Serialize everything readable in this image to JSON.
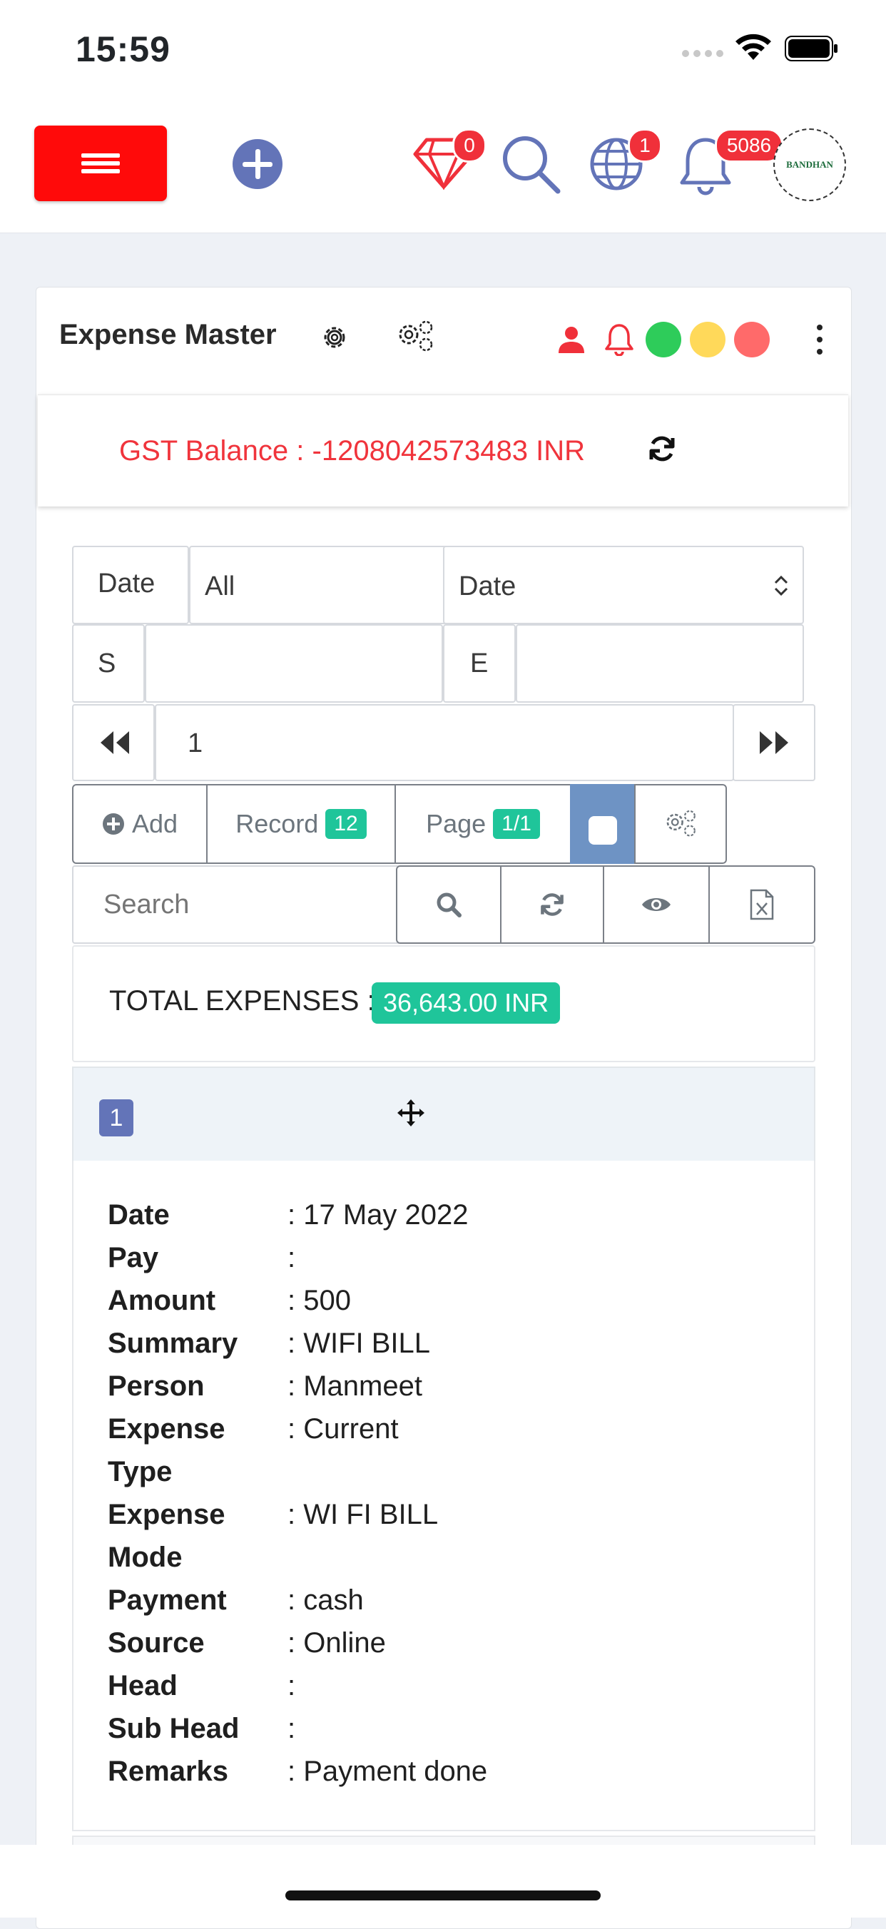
{
  "status_bar": {
    "time": "15:59"
  },
  "header": {
    "badges": {
      "gem": "0",
      "globe": "1",
      "bell": "5086"
    },
    "avatar_text": "BANDHAN"
  },
  "card": {
    "title": "Expense Master",
    "status_dot_colors": [
      "#2ecc5a",
      "#ffd95a",
      "#ff6a6a"
    ],
    "gst_balance": "GST Balance : -1208042573483 INR"
  },
  "filters": {
    "date_label": "Date",
    "range_select": "All",
    "field_select": "Date",
    "start_label": "S",
    "end_label": "E",
    "page_input": "1"
  },
  "toolbar": {
    "add_label": "Add",
    "record_label": "Record",
    "record_count": "12",
    "page_label": "Page",
    "page_value": "1/1",
    "search_placeholder": "Search"
  },
  "totals": {
    "label": "TOTAL EXPENSES :",
    "value": "36,643.00 INR"
  },
  "record": {
    "index": "1",
    "fields": [
      {
        "key": "Date",
        "value": ": 17 May 2022"
      },
      {
        "key": "Pay",
        "value": ":"
      },
      {
        "key": "Amount",
        "value": ": 500"
      },
      {
        "key": "Summary",
        "value": ": WIFI BILL"
      },
      {
        "key": "Person",
        "value": ": Manmeet"
      },
      {
        "key": "Expense Type",
        "value": ": Current"
      },
      {
        "key": "Expense Mode",
        "value": ": WI FI BILL"
      },
      {
        "key": "Payment",
        "value": ": cash"
      },
      {
        "key": "Source",
        "value": ": Online"
      },
      {
        "key": "Head",
        "value": ":"
      },
      {
        "key": "Sub Head",
        "value": ":"
      },
      {
        "key": "Remarks",
        "value": ": Payment done"
      }
    ]
  }
}
